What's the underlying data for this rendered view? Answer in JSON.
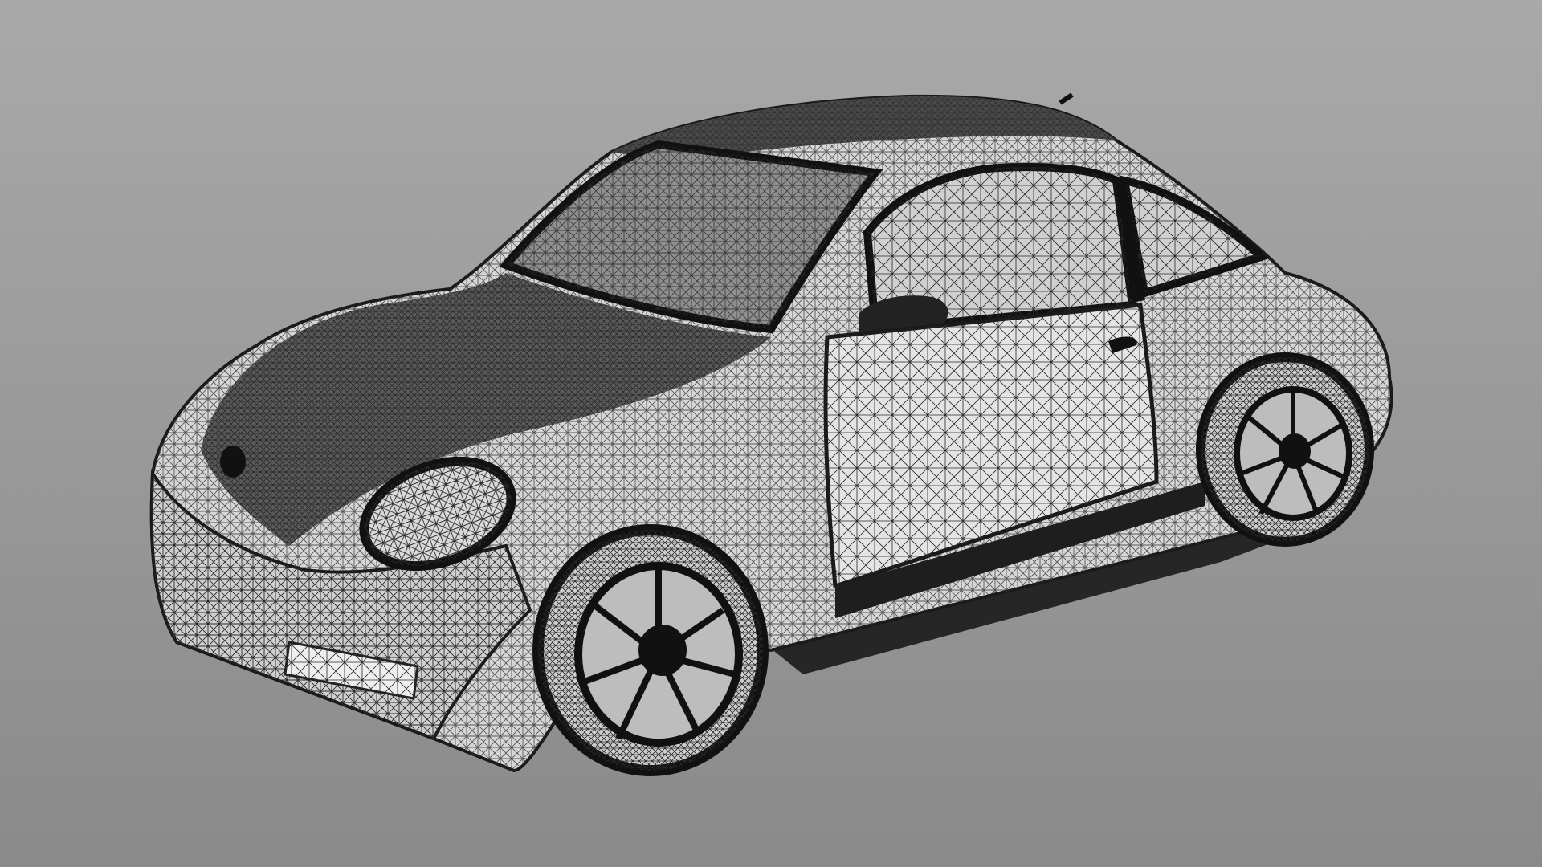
{
  "viewport": {
    "background_top": "#a9a9a9",
    "background_bottom": "#8a8a8a"
  },
  "model": {
    "subject": "wireframe-car-mesh",
    "render_style": "wireframe-on-shaded",
    "body_fill": "#d9d9d9",
    "dark_fill": "#1c1c1c",
    "mesh_line": "#2a2a2a"
  }
}
